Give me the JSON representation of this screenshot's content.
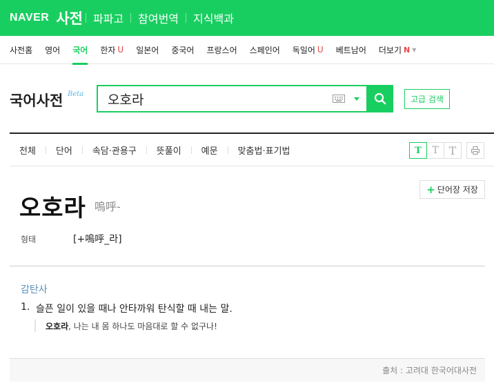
{
  "header": {
    "logo": "NAVER",
    "title": "사전",
    "links": [
      "파파고",
      "참여번역",
      "지식백과"
    ]
  },
  "lang_nav": {
    "items": [
      {
        "label": "사전홈",
        "badge": ""
      },
      {
        "label": "영어",
        "badge": ""
      },
      {
        "label": "국어",
        "badge": "",
        "active": true
      },
      {
        "label": "한자",
        "badge": "U"
      },
      {
        "label": "일본어",
        "badge": ""
      },
      {
        "label": "중국어",
        "badge": ""
      },
      {
        "label": "프랑스어",
        "badge": ""
      },
      {
        "label": "스페인어",
        "badge": ""
      },
      {
        "label": "독일어",
        "badge": "U"
      },
      {
        "label": "베트남어",
        "badge": ""
      }
    ],
    "more_label": "더보기",
    "more_badge": "N"
  },
  "search": {
    "dict_name": "국어사전",
    "beta": "Beta",
    "query": "오호라",
    "advanced_label": "고급 검색"
  },
  "filters": {
    "tabs": [
      "전체",
      "단어",
      "속담·관용구",
      "뜻풀이",
      "예문",
      "맞춤법·표기법"
    ],
    "font_sizes": [
      "T",
      "T",
      "T"
    ]
  },
  "entry": {
    "save_label": "단어장 저장",
    "headword": "오호라",
    "hanja": "嗚呼-",
    "form_label": "형태",
    "form_value": "[+嗚呼_라]",
    "part_of_speech": "감탄사",
    "definitions": [
      {
        "num": "1.",
        "text": "슬픈 일이 있을 때나 안타까워 탄식할 때 내는 말.",
        "example_word": "오호라",
        "example_rest": ", 나는 내 몸 하나도 마음대로 할 수 없구나!"
      }
    ]
  },
  "source": "출처 : 고려대 한국어대사전",
  "colors": {
    "brand_green": "#19ce60",
    "badge_red": "#e84545",
    "pos_blue": "#5b8fb9"
  }
}
